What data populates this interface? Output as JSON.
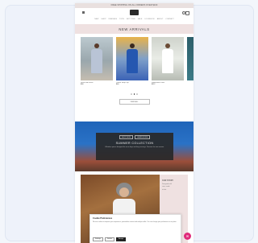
{
  "announcement": "FREE SHIPPING ON ALL ORDERS OVER $100",
  "nav": [
    "NEW",
    "SHOP",
    "DRESSES",
    "TOPS",
    "BOTTOMS",
    "SALE",
    "LOOKBOOK",
    "ABOUT",
    "CONTACT"
  ],
  "banner_title": "NEW ARRIVALS",
  "products": [
    {
      "title": "Linen Midi Dress",
      "price": "$98"
    },
    {
      "title": "Cotton Wrap Top",
      "price": "$64"
    },
    {
      "title": "Sleeveless Dress",
      "price": "$112"
    },
    {
      "title": "",
      "price": ""
    }
  ],
  "carousel": {
    "count": 3,
    "active": 1
  },
  "view_all_label": "VIEW ALL",
  "hero": {
    "tab1": "SHOP NOW",
    "tab2": "LEARN MORE",
    "title": "SUMMER COLLECTION",
    "text": "Effortless pieces designed for warm days and long evenings. Discover the new season."
  },
  "feature_side": {
    "title": "OUR STORY",
    "lines": [
      "Designed with",
      "care, made",
      "to last."
    ]
  },
  "cookie": {
    "title": "Cookie Preferences",
    "text": "We use cookies to improve your experience, personalise content and analyse traffic. You can change your preferences at any time.",
    "settings_label": "Settings",
    "decline_label": "Decline",
    "accept_label": "Accept"
  },
  "colors": {
    "accent": "#e02a7a",
    "banner": "#efe1e1",
    "hero_blue": "#1f64b9"
  },
  "icons": [
    "menu-icon",
    "search-icon",
    "cart-icon",
    "chat-icon"
  ]
}
